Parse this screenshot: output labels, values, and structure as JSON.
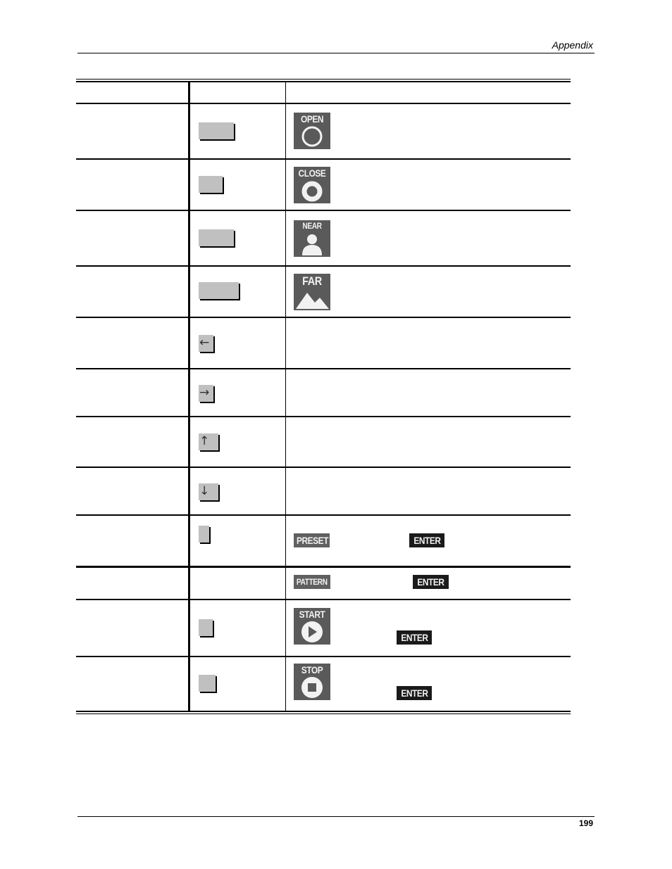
{
  "header": {
    "section": "Appendix"
  },
  "footer": {
    "page_number": "199"
  },
  "table": {
    "header_row": {
      "col1": "",
      "col2": "",
      "col3": ""
    },
    "rows": [
      {
        "id": "open",
        "key_glyph": "",
        "icon": "open-icon",
        "icon_label": "OPEN"
      },
      {
        "id": "close",
        "key_glyph": "",
        "icon": "close-icon",
        "icon_label": "CLOSE"
      },
      {
        "id": "near",
        "key_glyph": "",
        "icon": "near-icon",
        "icon_label": "NEAR"
      },
      {
        "id": "far",
        "key_glyph": "",
        "icon": "far-icon",
        "icon_label": "FAR"
      },
      {
        "id": "left",
        "key_glyph": "←"
      },
      {
        "id": "right",
        "key_glyph": "→"
      },
      {
        "id": "up",
        "key_glyph": "↑"
      },
      {
        "id": "down",
        "key_glyph": "↓"
      },
      {
        "id": "preset",
        "key_glyph": "",
        "tag_label": "PRESET",
        "enter_label": "ENTER"
      },
      {
        "id": "pattern",
        "tag_label": "PATTERN",
        "enter_label": "ENTER"
      },
      {
        "id": "start",
        "key_glyph": "",
        "icon": "start-icon",
        "icon_label": "START",
        "enter_label": "ENTER"
      },
      {
        "id": "stop",
        "key_glyph": "",
        "icon": "stop-icon",
        "icon_label": "STOP",
        "enter_label": "ENTER"
      }
    ]
  },
  "colors": {
    "key_face": "#c0c0c0",
    "icon_bg": "#5a5a5a",
    "enter_bg": "#1a1a1a"
  }
}
